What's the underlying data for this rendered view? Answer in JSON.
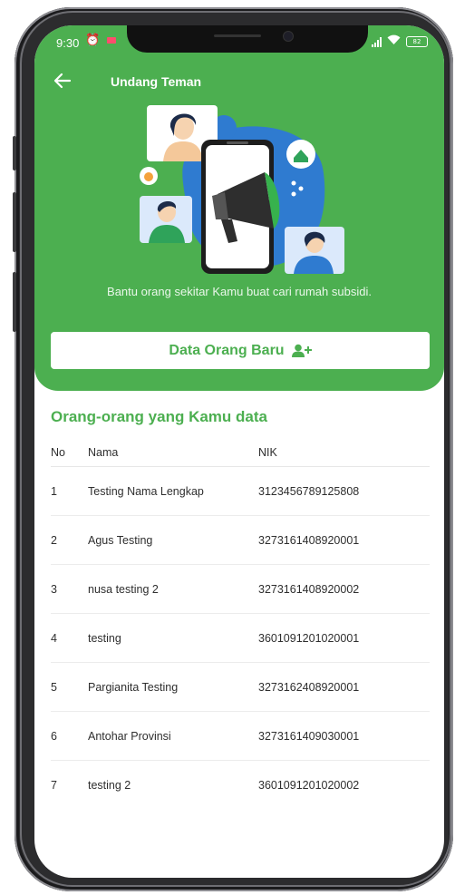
{
  "status_bar": {
    "time": "9:30",
    "battery": "82"
  },
  "header": {
    "title": "Undang Teman",
    "tagline": "Bantu orang sekitar Kamu buat cari rumah subsidi.",
    "cta_label": "Data Orang Baru"
  },
  "section": {
    "title": "Orang-orang yang Kamu data"
  },
  "table": {
    "columns": {
      "no": "No",
      "name": "Nama",
      "nik": "NIK"
    },
    "rows": [
      {
        "no": "1",
        "name": "Testing Nama Lengkap",
        "nik": "3123456789125808"
      },
      {
        "no": "2",
        "name": "Agus Testing",
        "nik": "3273161408920001"
      },
      {
        "no": "3",
        "name": "nusa testing 2",
        "nik": "3273161408920002"
      },
      {
        "no": "4",
        "name": "testing",
        "nik": "3601091201020001"
      },
      {
        "no": "5",
        "name": "Pargianita Testing",
        "nik": "3273162408920001"
      },
      {
        "no": "6",
        "name": "Antohar Provinsi",
        "nik": "3273161409030001"
      },
      {
        "no": "7",
        "name": "testing 2",
        "nik": "3601091201020002"
      }
    ]
  },
  "colors": {
    "brand_green": "#4caf50",
    "text": "#2e2e2e"
  }
}
